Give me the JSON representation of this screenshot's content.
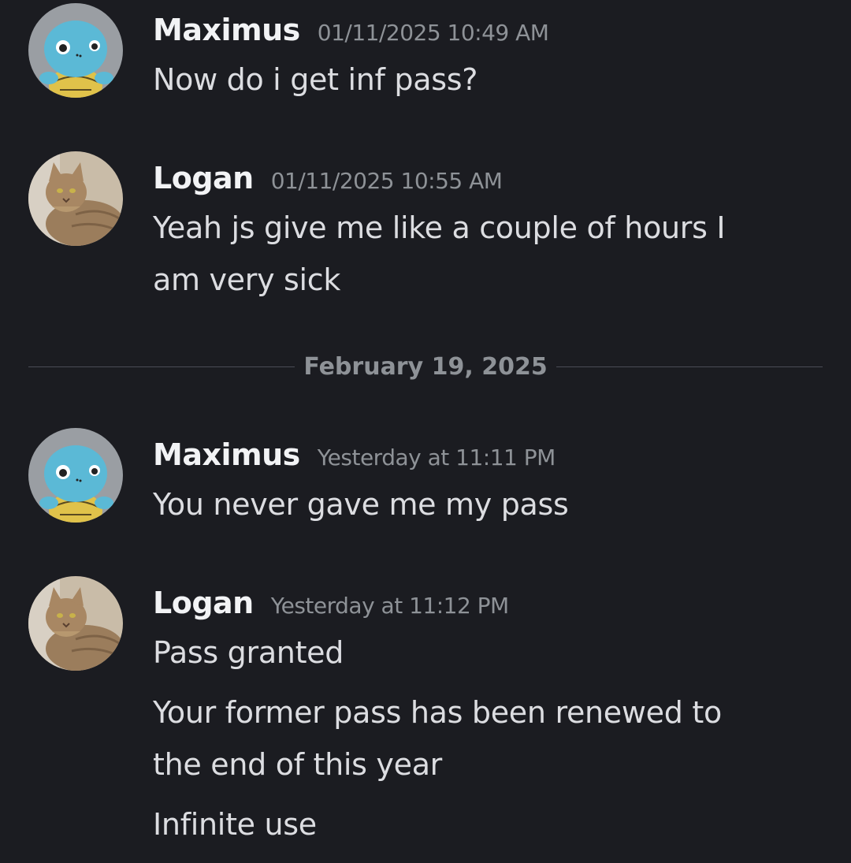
{
  "messages": [
    {
      "author": "Maximus",
      "timestamp": "01/11/2025 10:49 AM",
      "avatar": "squirtle-plush-avatar",
      "lines": [
        "Now do i get inf pass?"
      ]
    },
    {
      "author": "Logan",
      "timestamp": "01/11/2025 10:55 AM",
      "avatar": "cat-avatar",
      "lines": [
        "Yeah js give me like a couple of hours I",
        "am very sick"
      ]
    },
    {
      "author": "Maximus",
      "timestamp": "Yesterday at 11:11 PM",
      "avatar": "squirtle-plush-avatar",
      "lines": [
        "You never gave me my pass"
      ]
    },
    {
      "author": "Logan",
      "timestamp": "Yesterday at 11:12 PM",
      "avatar": "cat-avatar",
      "lines": [
        "Pass granted",
        "Your former pass has been renewed to",
        "the end of this year",
        "Infinite use"
      ]
    }
  ],
  "date_divider": "February 19, 2025",
  "colors": {
    "background": "#1b1c21",
    "author": "#f2f3f5",
    "timestamp": "#8e9297",
    "text": "#dcdde1",
    "divider": "#4a4c55"
  }
}
